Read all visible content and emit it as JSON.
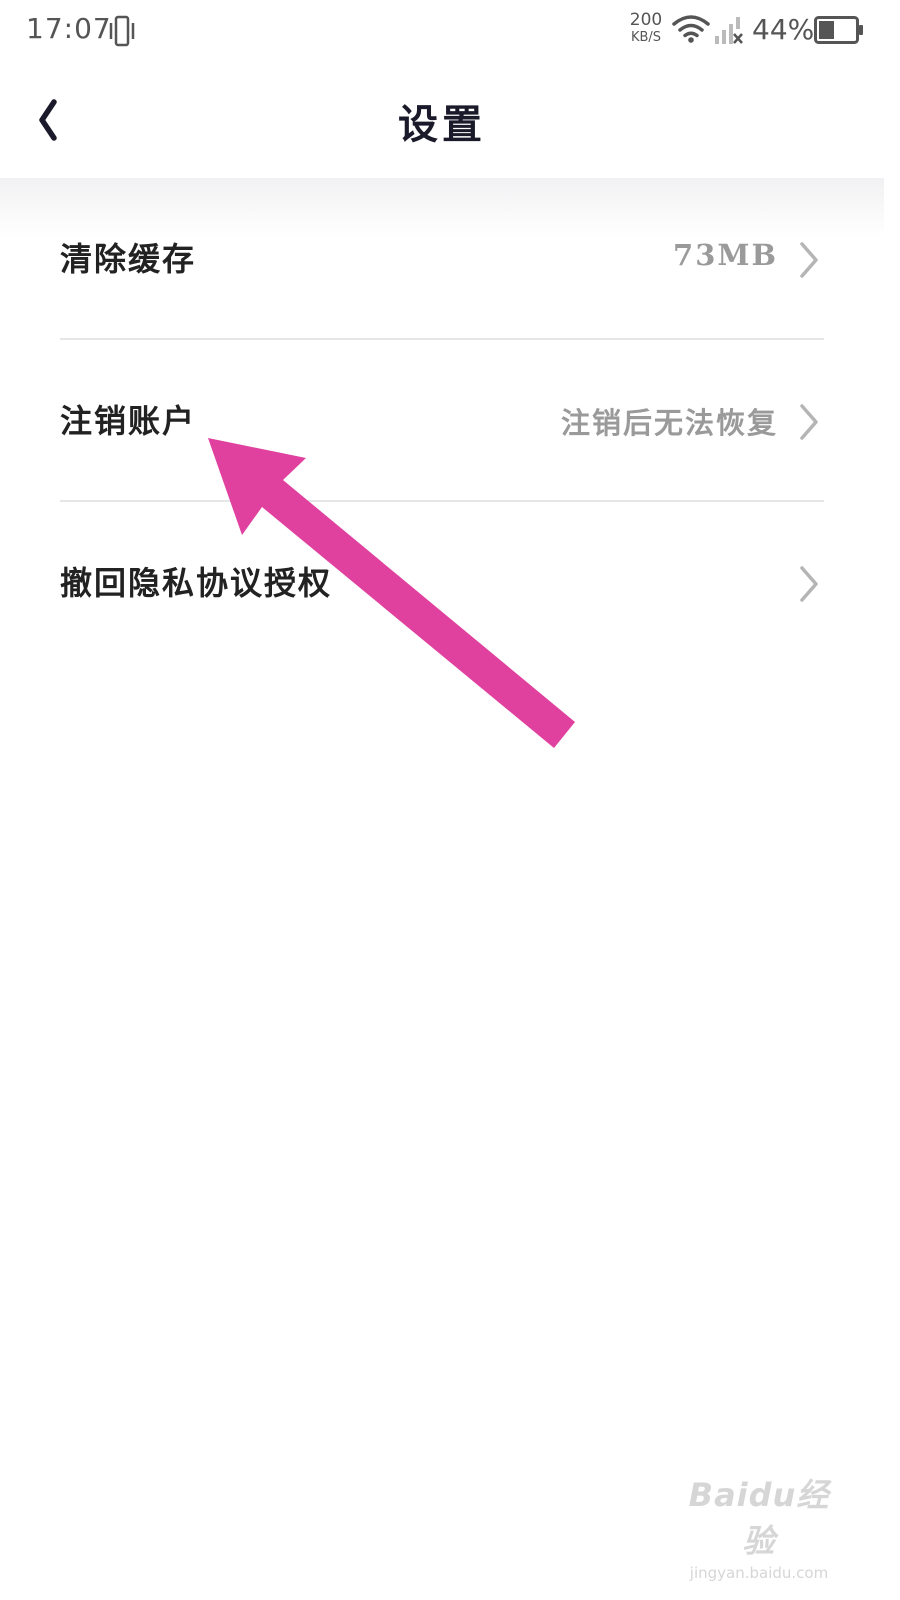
{
  "status_bar": {
    "time": "17:07",
    "net_speed_value": "200",
    "net_speed_unit": "KB/S",
    "battery_percent": "44%",
    "battery_level": 0.44,
    "icons": [
      "vibrate-icon",
      "wifi-icon",
      "signal-icon",
      "battery-icon"
    ]
  },
  "header": {
    "back_icon": "chevron-left-icon",
    "title": "设置"
  },
  "settings": {
    "items": [
      {
        "label": "清除缓存",
        "value": "73MB",
        "icon": "chevron-right-icon"
      },
      {
        "label": "注销账户",
        "value": "注销后无法恢复",
        "icon": "chevron-right-icon"
      },
      {
        "label": "撤回隐私协议授权",
        "value": "",
        "icon": "chevron-right-icon"
      }
    ]
  },
  "annotation": {
    "color": "#e0409e",
    "target": "注销账户"
  },
  "watermark": {
    "logo_text": "Baidu经验",
    "url": "jingyan.baidu.com"
  },
  "colors": {
    "title": "#1a1a2a",
    "label": "#222222",
    "secondary": "#9a9a9a",
    "divider": "#e6e6e6",
    "arrow": "#e0409e"
  }
}
